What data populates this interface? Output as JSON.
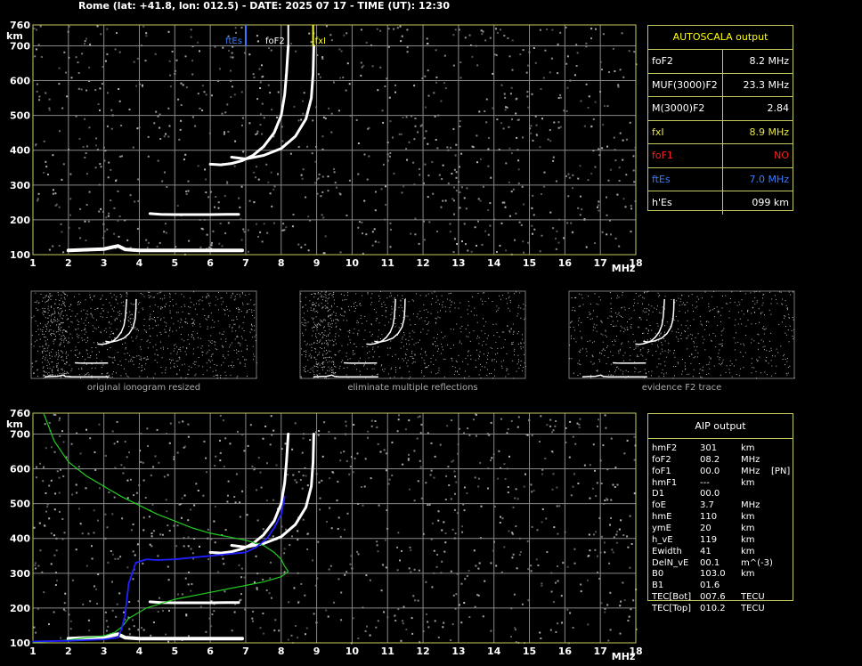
{
  "header": {
    "title": "Rome (lat: +41.8, lon: 012.5) - DATE: 2025 07 17 - TIME (UT): 12:30"
  },
  "colors": {
    "grid": "#888888",
    "frame": "#c8c860",
    "fEs": "#3a7bff",
    "fxI": "#ffff00",
    "foF1": "#ff2020",
    "aipProfile": "#22cc22",
    "aipTrace": "#2020ff"
  },
  "autoscala": {
    "title": "AUTOSCALA output",
    "rows": [
      {
        "label": "foF2",
        "value": "8.2 MHz",
        "color": "#ffffff"
      },
      {
        "label": "MUF(3000)F2",
        "value": "23.3 MHz",
        "color": "#ffffff"
      },
      {
        "label": "M(3000)F2",
        "value": "2.84",
        "color": "#ffffff"
      },
      {
        "label": "fxI",
        "value": "8.9 MHz",
        "color": "#e6e64a"
      },
      {
        "label": "foF1",
        "value": "NO",
        "color": "#ff2020"
      },
      {
        "label": "ftEs",
        "value": "7.0 MHz",
        "color": "#3a7bff"
      },
      {
        "label": "h'Es",
        "value": "099    km",
        "color": "#ffffff"
      }
    ]
  },
  "aip": {
    "title": "AIP output",
    "rows": [
      {
        "name": "hmF2",
        "value": "301",
        "unit": "km",
        "extra": ""
      },
      {
        "name": "foF2",
        "value": "08.2",
        "unit": "MHz",
        "extra": ""
      },
      {
        "name": "foF1",
        "value": "00.0",
        "unit": "MHz",
        "extra": "[PN]"
      },
      {
        "name": "hmF1",
        "value": "---",
        "unit": "km",
        "extra": ""
      },
      {
        "name": "D1",
        "value": "00.0",
        "unit": "",
        "extra": ""
      },
      {
        "name": "foE",
        "value": "3.7",
        "unit": "MHz",
        "extra": ""
      },
      {
        "name": "hmE",
        "value": "110",
        "unit": "km",
        "extra": ""
      },
      {
        "name": "ymE",
        "value": "20",
        "unit": "km",
        "extra": ""
      },
      {
        "name": "h_vE",
        "value": "119",
        "unit": "km",
        "extra": ""
      },
      {
        "name": "Ewidth",
        "value": "41",
        "unit": "km",
        "extra": ""
      },
      {
        "name": "DelN_vE",
        "value": "00.1",
        "unit": "m^(-3)",
        "extra": ""
      },
      {
        "name": "B0",
        "value": "103.0",
        "unit": "km",
        "extra": ""
      },
      {
        "name": "B1",
        "value": "01.6",
        "unit": "",
        "extra": ""
      },
      {
        "name": "TEC[Bot]",
        "value": "007.6",
        "unit": "TECU",
        "extra": ""
      },
      {
        "name": "TEC[Top]",
        "value": "010.2",
        "unit": "TECU",
        "extra": ""
      }
    ]
  },
  "captions": [
    "original ionogram resized",
    "eliminate multiple reflections",
    "evidence F2 trace"
  ],
  "chart_data": [
    {
      "type": "scatter",
      "xlabel": "MHz",
      "ylabel": "km",
      "xlim": [
        1,
        18
      ],
      "ylim": [
        100,
        760
      ],
      "x_ticks": [
        "1",
        "2",
        "3",
        "4",
        "5",
        "6",
        "7",
        "8",
        "9",
        "10",
        "11",
        "12",
        "13",
        "14",
        "15",
        "16",
        "17",
        "18"
      ],
      "y_ticks": [
        "100",
        "200",
        "300",
        "400",
        "500",
        "600",
        "700",
        "760"
      ],
      "markers": [
        {
          "label": "ftEs",
          "x": 7.0,
          "color": "#3a7bff"
        },
        {
          "label": "foF2",
          "x": 8.2,
          "color": "#ffffff"
        },
        {
          "label": "fxI",
          "x": 8.9,
          "color": "#ffff00"
        }
      ],
      "series": [
        {
          "x": [
            6.0,
            6.3,
            6.6,
            6.9,
            7.2,
            7.5,
            7.8,
            8.0,
            8.1,
            8.15,
            8.2
          ],
          "y": [
            360,
            358,
            362,
            370,
            385,
            410,
            450,
            500,
            560,
            620,
            700
          ]
        },
        {
          "x": [
            6.6,
            7.0,
            7.5,
            8.0,
            8.4,
            8.7,
            8.85,
            8.9,
            8.92
          ],
          "y": [
            380,
            375,
            385,
            405,
            440,
            490,
            550,
            620,
            700
          ]
        },
        {
          "x": [
            4.3,
            4.6,
            5.0,
            5.5,
            6.0,
            6.5,
            6.8
          ],
          "y": [
            218,
            216,
            215,
            215,
            215,
            216,
            216
          ]
        },
        {
          "x": [
            2.0,
            2.5,
            3.0,
            3.4,
            3.6,
            4.0,
            5.0,
            6.0,
            6.9
          ],
          "y": [
            112,
            114,
            116,
            125,
            115,
            112,
            112,
            112,
            112
          ]
        }
      ]
    },
    {
      "type": "line",
      "xlabel": "MHz",
      "ylabel": "km",
      "xlim": [
        1,
        18
      ],
      "ylim": [
        100,
        760
      ],
      "x_ticks": [
        "1",
        "2",
        "3",
        "4",
        "5",
        "6",
        "7",
        "8",
        "9",
        "10",
        "11",
        "12",
        "13",
        "14",
        "15",
        "16",
        "17",
        "18"
      ],
      "y_ticks": [
        "100",
        "200",
        "300",
        "400",
        "500",
        "600",
        "700",
        "760"
      ],
      "series": [
        {
          "x": [
            1.3,
            1.6,
            2.0,
            2.5,
            3.0,
            3.5,
            4.0,
            4.5,
            5.0,
            5.5,
            6.0,
            6.5,
            7.0,
            7.5,
            7.8,
            8.0,
            8.1,
            8.2,
            8.0,
            7.5,
            7.0,
            6.0,
            5.0,
            4.2,
            3.7,
            3.5,
            3.3,
            3.0,
            2.5,
            2.0,
            1.5,
            1.0
          ],
          "y": [
            760,
            680,
            620,
            580,
            550,
            520,
            495,
            470,
            450,
            430,
            415,
            405,
            395,
            380,
            360,
            340,
            320,
            305,
            290,
            275,
            265,
            245,
            225,
            200,
            170,
            145,
            130,
            120,
            115,
            108,
            104,
            102
          ]
        },
        {
          "x": [
            1.0,
            2.0,
            3.0,
            3.4,
            3.5,
            3.6,
            3.7,
            3.9,
            4.2,
            4.5,
            5.0,
            5.5,
            6.0,
            6.5,
            7.0,
            7.3,
            7.6,
            7.8,
            8.0,
            8.1
          ],
          "y": [
            104,
            106,
            110,
            115,
            140,
            180,
            270,
            330,
            340,
            338,
            340,
            345,
            350,
            355,
            360,
            375,
            400,
            430,
            470,
            520
          ]
        }
      ],
      "virtual_traces": [
        {
          "x": [
            6.0,
            6.3,
            6.6,
            6.9,
            7.2,
            7.5,
            7.8,
            8.0,
            8.1,
            8.15,
            8.2
          ],
          "y": [
            360,
            358,
            362,
            370,
            385,
            410,
            450,
            500,
            560,
            620,
            700
          ]
        },
        {
          "x": [
            6.6,
            7.0,
            7.5,
            8.0,
            8.4,
            8.7,
            8.85,
            8.9,
            8.92
          ],
          "y": [
            380,
            375,
            385,
            405,
            440,
            490,
            550,
            620,
            700
          ]
        },
        {
          "x": [
            4.3,
            4.6,
            5.0,
            5.5,
            6.0,
            6.5,
            6.8
          ],
          "y": [
            218,
            216,
            215,
            215,
            215,
            216,
            216
          ]
        },
        {
          "x": [
            2.0,
            2.5,
            3.0,
            3.4,
            3.6,
            4.0,
            5.0,
            6.0,
            6.9
          ],
          "y": [
            112,
            114,
            116,
            125,
            115,
            112,
            112,
            112,
            112
          ]
        }
      ]
    }
  ]
}
